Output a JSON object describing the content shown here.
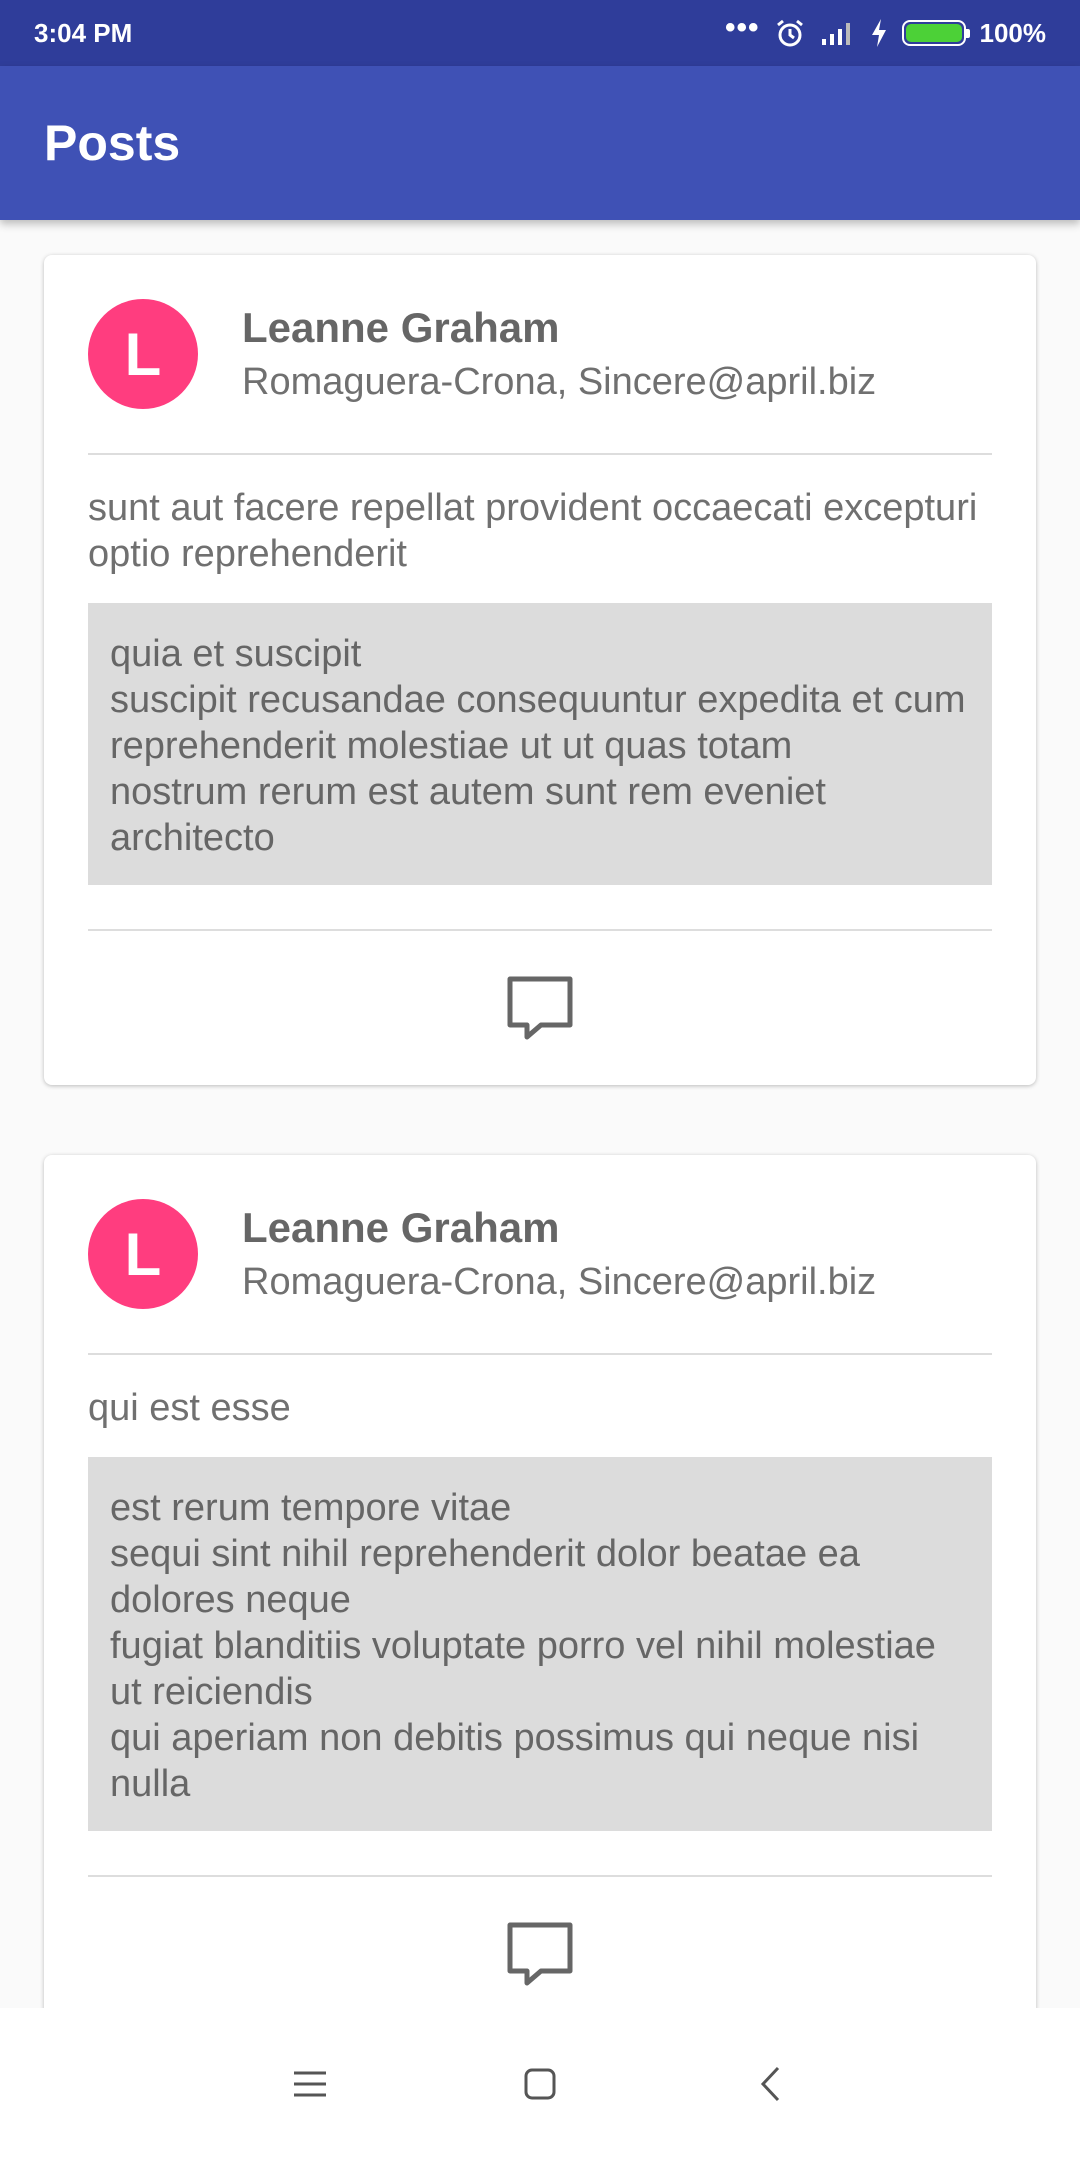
{
  "status_bar": {
    "time": "3:04 PM",
    "battery_percent": "100%",
    "icons": [
      "more-dots-icon",
      "alarm-icon",
      "signal-icon",
      "charging-icon",
      "battery-icon"
    ]
  },
  "app_bar": {
    "title": "Posts"
  },
  "posts": [
    {
      "avatar_letter": "L",
      "author_name": "Leanne Graham",
      "author_sub": "Romaguera-Crona, Sincere@april.biz",
      "title": "sunt aut facere repellat provident occaecati excepturi optio reprehenderit",
      "body": "quia et suscipit\nsuscipit recusandae consequuntur expedita et cum\nreprehenderit molestiae ut ut quas totam\nnostrum rerum est autem sunt rem eveniet architecto",
      "footer_icon": "comment-icon"
    },
    {
      "avatar_letter": "L",
      "author_name": "Leanne Graham",
      "author_sub": "Romaguera-Crona, Sincere@april.biz",
      "title": "qui est esse",
      "body": "est rerum tempore vitae\nsequi sint nihil reprehenderit dolor beatae ea dolores neque\nfugiat blanditiis voluptate porro vel nihil molestiae ut reiciendis\nqui aperiam non debitis possimus qui neque nisi nulla",
      "footer_icon": "comment-icon"
    }
  ],
  "nav_bar": {
    "icons": [
      "menu-icon",
      "home-icon",
      "back-icon"
    ]
  },
  "colors": {
    "status_bar": "#2f3d9a",
    "app_bar": "#3f51b5",
    "avatar": "#ff3d7f",
    "body_bg": "#dcdcdc"
  }
}
